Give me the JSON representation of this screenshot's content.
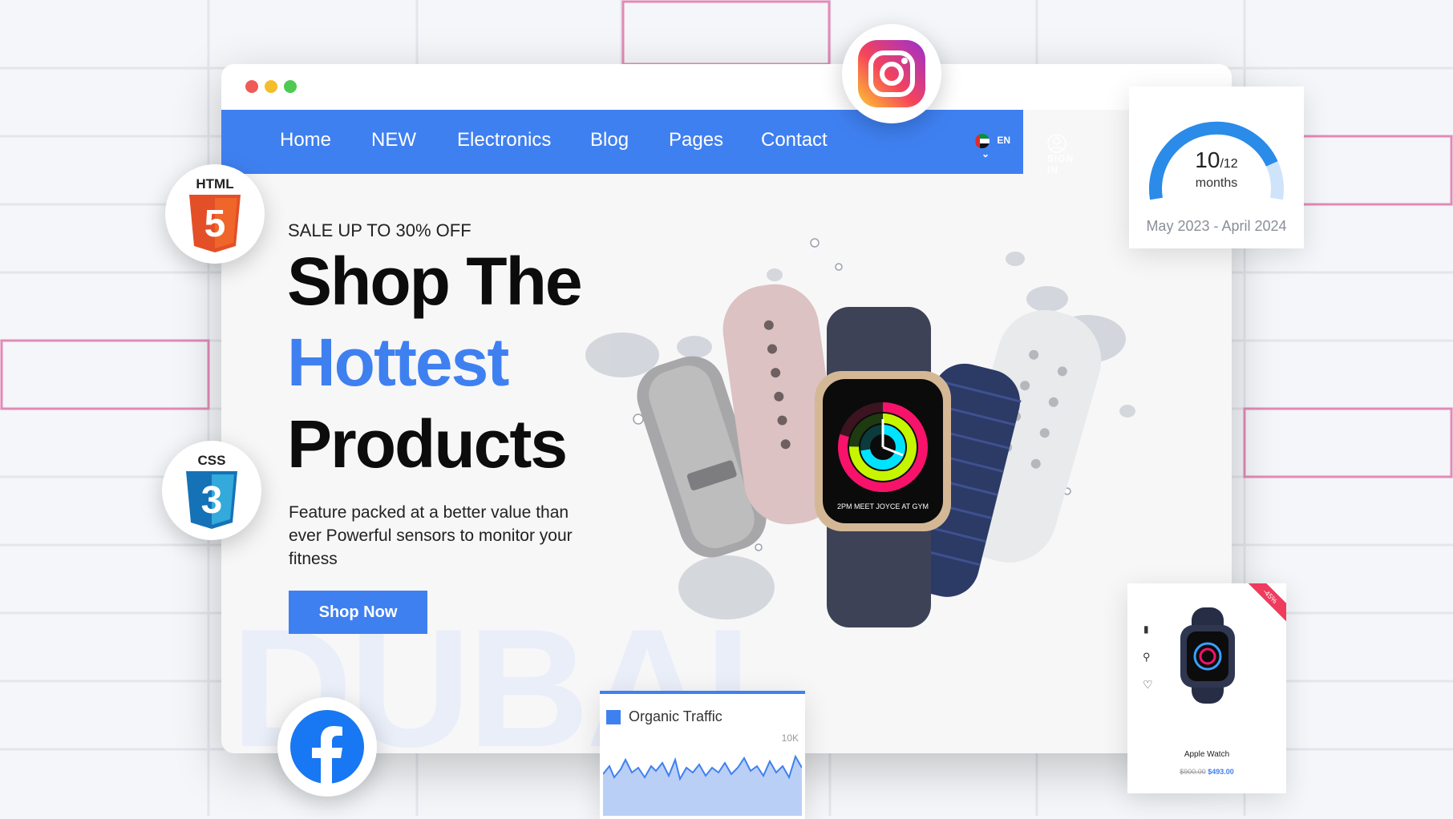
{
  "nav": {
    "items": [
      "Home",
      "NEW",
      "Electronics",
      "Blog",
      "Pages",
      "Contact"
    ],
    "language": "EN",
    "signin": "SIGN IN"
  },
  "hero": {
    "sale": "SALE UP TO 30% OFF",
    "line1": "Shop The",
    "line2": "Hottest",
    "line3": "Products",
    "description": "Feature packed at a better value than ever Powerful sensors to monitor your fitness",
    "button": "Shop Now",
    "watermark": "DUBAI",
    "watch_screen_text": "2PM MEET JOYCE AT GYM"
  },
  "gauge": {
    "value": "10",
    "total": "/12",
    "unit": "months",
    "progress_fraction": 0.83,
    "range": "May 2023 - April 2024"
  },
  "traffic": {
    "title": "Organic Traffic",
    "axis_label": "10K"
  },
  "product": {
    "name": "Apple Watch",
    "old_price": "$900.00",
    "new_price": "$493.00",
    "ribbon": "-45%"
  },
  "badges": {
    "html": "HTML",
    "html_digit": "5",
    "css": "CSS",
    "css_digit": "3"
  },
  "colors": {
    "primary": "#3f80f1",
    "grid_pink": "#e38ab8",
    "traffic_fill": "#b9cff5"
  }
}
